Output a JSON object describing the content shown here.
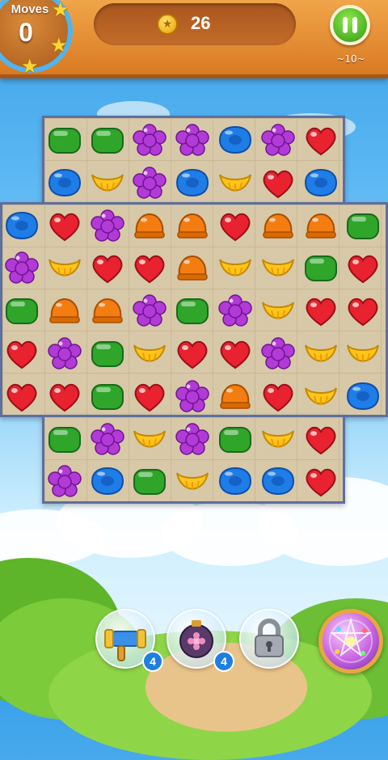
{
  "header": {
    "moves_label": "Moves",
    "moves_value": "0",
    "coins_value": "26",
    "level_label": "~10~",
    "stars_count": 3
  },
  "board": {
    "rows": [
      [
        "",
        "green",
        "green",
        "purple",
        "purple",
        "blue",
        "purple",
        "red",
        ""
      ],
      [
        "",
        "blue",
        "yellow",
        "purple",
        "blue",
        "yellow",
        "red",
        "blue",
        ""
      ],
      [
        "blue",
        "red",
        "purple",
        "orange",
        "orange",
        "red",
        "orange",
        "orange",
        "green"
      ],
      [
        "purple",
        "yellow",
        "red",
        "red",
        "orange",
        "yellow",
        "yellow",
        "green",
        "red"
      ],
      [
        "green",
        "orange",
        "orange",
        "purple",
        "green",
        "purple",
        "yellow",
        "red",
        "red"
      ],
      [
        "red",
        "purple",
        "green",
        "yellow",
        "red",
        "red",
        "purple",
        "yellow",
        "yellow"
      ],
      [
        "red",
        "red",
        "green",
        "red",
        "purple",
        "orange",
        "red",
        "yellow",
        "blue"
      ],
      [
        "",
        "green",
        "purple",
        "yellow",
        "purple",
        "green",
        "yellow",
        "red",
        ""
      ],
      [
        "",
        "purple",
        "blue",
        "green",
        "yellow",
        "blue",
        "blue",
        "red",
        ""
      ]
    ]
  },
  "boosters": [
    {
      "icon": "hammer-icon",
      "count": "4"
    },
    {
      "icon": "flower-bomb-icon",
      "count": "4"
    },
    {
      "icon": "lock-icon",
      "count": ""
    }
  ],
  "colors": {
    "red": "#e8222e",
    "green": "#2fa62a",
    "purple": "#b23ad6",
    "blue": "#1e7de6",
    "yellow": "#ffc51a",
    "orange": "#f47d12"
  }
}
